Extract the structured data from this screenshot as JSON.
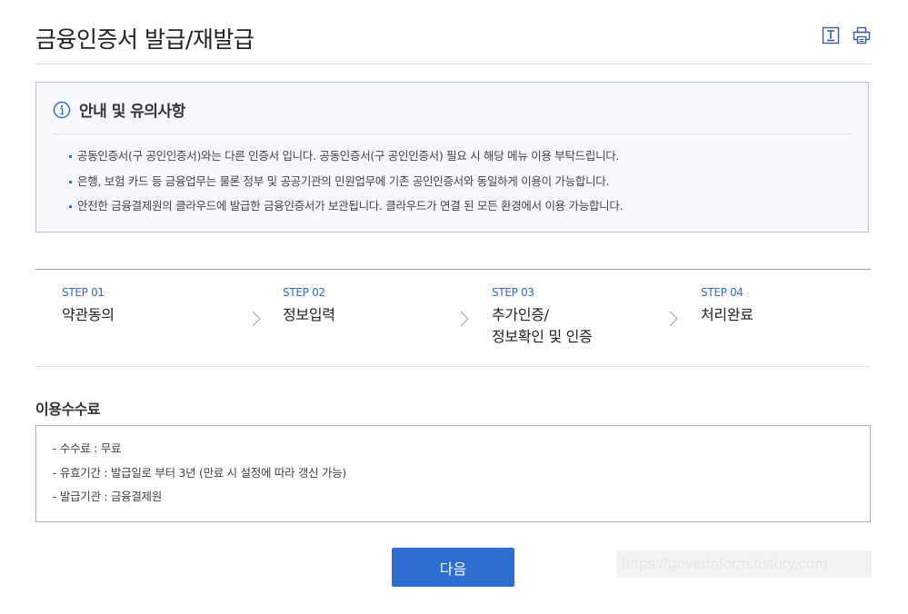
{
  "page": {
    "title": "금융인증서 발급/재발급",
    "tools": [
      {
        "icon": "text-size-icon"
      },
      {
        "icon": "print-icon"
      }
    ]
  },
  "notice": {
    "icon": "info-icon",
    "title": "안내 및 유의사항",
    "items": [
      "공동인증서(구 공인인증서)와는 다른 인증서 입니다. 공동인증서(구 공인인증서) 필요 시 해당 메뉴 이용 부탁드립니다.",
      "은행, 보험 카드 등 금융업무는 물론 정부 및 공공기관의 민원업무에 기존 공인인증서와 동일하게 이용이 가능합니다.",
      "안전한 금융결제원의 클라우드에 발급한 금융인증서가 보관됩니다. 클라우드가 연결 된 모든 환경에서 이용 가능합니다."
    ],
    "accent_color": "#3a6fd8"
  },
  "steps": [
    {
      "num": "STEP 01",
      "label": "약관동의"
    },
    {
      "num": "STEP 02",
      "label": "정보입력"
    },
    {
      "num": "STEP 03",
      "label_line1": "추가인증/",
      "label_line2": "정보확인 및 인증"
    },
    {
      "num": "STEP 04",
      "label": "처리완료"
    }
  ],
  "fee": {
    "title": "이용수수료",
    "items": [
      "- 수수료 : 무료",
      "- 유효기간 : 발급일로 부터 3년 (만료 시 설정에 따라 갱신 가능)",
      "- 발급기관 : 금융결제원"
    ]
  },
  "actions": {
    "next_label": "다음",
    "next_color": "#2d6fd1"
  },
  "watermark": "https://goverinform.tistory.com"
}
